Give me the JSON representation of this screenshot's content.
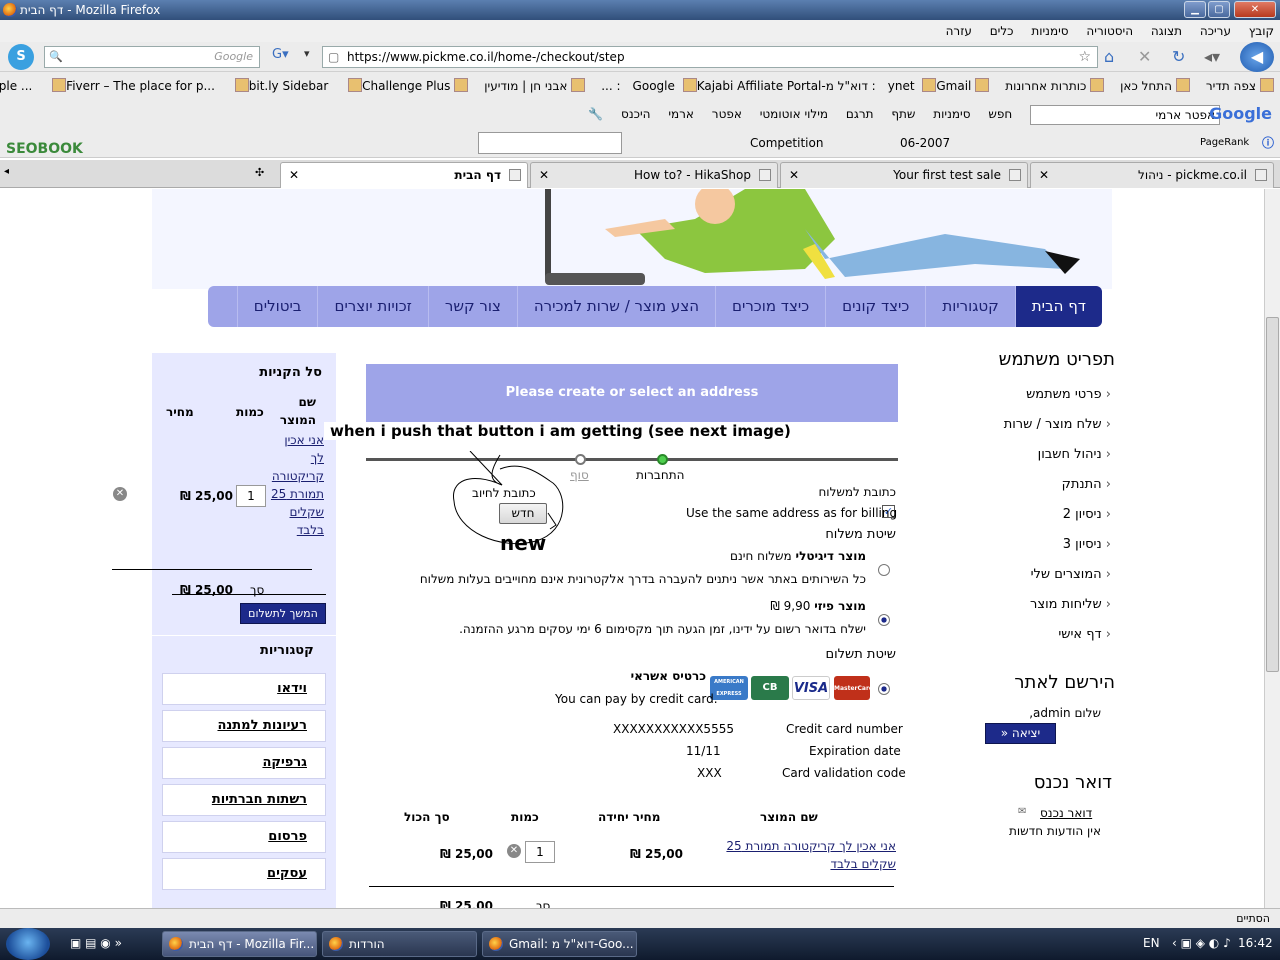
{
  "window": {
    "title": "דף הבית - Mozilla Firefox"
  },
  "menu": [
    "קובץ",
    "עריכה",
    "תצוגה",
    "היסטוריה",
    "סימניות",
    "כלים",
    "עזרה"
  ],
  "nav": {
    "url": "https://www.pickme.co.il/home-/checkout/step",
    "search_placeholder": "Google"
  },
  "bookmarks": [
    "צפה תדיר",
    "התחל כאן",
    "כותרות אחרונות",
    "ynet",
    "Gmail: דוא\"ל מ-Google",
    "Kajabi Affiliate Portal: ...",
    "אבני חן | מודיעין",
    "bit.ly | Basic | a simple ...",
    "Fiverr – The place for p...",
    "bit.ly Sidebar",
    "Challenge Plus"
  ],
  "toolbar1": {
    "google_search_value": "אפטר ארמי",
    "items": [
      "חפש",
      "סימניות",
      "שתף",
      "תרגם",
      "מילוי אוטומטי",
      "אפטר",
      "ארמי",
      "היכנס"
    ]
  },
  "toolbar2": {
    "brand": "SEOBOOK",
    "competition": "Competition",
    "pagerank": "PageRank",
    "date": "06-2007"
  },
  "tabs": [
    {
      "label": "ניהול - pickme.co.il"
    },
    {
      "label": "Your first test sale"
    },
    {
      "label": "How to? - HikaShop"
    },
    {
      "label": "דף הבית"
    }
  ],
  "mainnav": [
    "דף הבית",
    "קטגוריות",
    "כיצד קונים",
    "כיצד מוכרים",
    "הצע מוצר / שרות למכירה",
    "צור קשר",
    "זכויות יוצרים",
    "ביטולים"
  ],
  "cart": {
    "title": "סל הקניות",
    "col_name": "שם המוצר",
    "col_qty": "כמות",
    "col_price": "מחיר",
    "item_name": "אני אכין לך קריקטורה תמורת 25 שקלים בלבד",
    "item_qty": "1",
    "item_price": "25,00 ₪",
    "total_label": "סך",
    "total_value": "25,00 ₪",
    "continue_button": "המשך לתשלום"
  },
  "categories": {
    "title": "קטגוריות",
    "items": [
      "וידאו",
      "רעיונות למתנה",
      "גרפיקה",
      "רשתות חברתיות",
      "פרסום",
      "עסקים"
    ]
  },
  "checkout": {
    "address_banner": "Please create or select an address",
    "annotation": "when i push that button i am getting (see next image)",
    "annotation_new": "new",
    "steps": [
      "התחברות",
      "סוף"
    ],
    "billing_address_label": "כתובת לחיוב",
    "new_button": "חדש",
    "shipping_address_label": "כתובת למשלוח",
    "same_address_label": "Use the same address as for billing",
    "shipping_method_title": "שיטת משלוח",
    "ship1_name": "מוצר דיגיטלי",
    "ship1_price": "משלוח חינם",
    "ship1_desc": "כל השירותים באתר אשר ניתנים להעברה בדרך אלקטרונית אינם מחוייבים בעלות משלוח",
    "ship2_name": "מוצר פיזי",
    "ship2_price": "9,90 ₪",
    "ship2_desc": "ישלח בדואר רשום על ידינו, זמן הגעה תוך מקסימום 6 ימי עסקים מרגע ההזמנה.",
    "payment_method_title": "שיטת תשלום",
    "pay_name": "כרטיס אשראי",
    "pay_desc": "You can pay by credit card.",
    "cards": [
      "MasterCard",
      "VISA",
      "CB",
      "AMERICAN EXPRESS"
    ],
    "cc_number_label": "Credit card number",
    "cc_number_value": "XXXXXXXXXXX5555",
    "exp_label": "Expiration date",
    "exp_value": "11/11",
    "cvv_label": "Card validation code",
    "cvv_value": "XXX",
    "summary_cols": [
      "שם המוצר",
      "מחיר יחידה",
      "כמות",
      "סך הכול"
    ],
    "summary_item": "אני אכין לך קריקטורה תמורת 25 שקלים בלבד",
    "summary_unit_price": "25,00 ₪",
    "summary_qty": "1",
    "summary_total": "25,00 ₪",
    "summary_footer_label": "סך",
    "summary_footer_value": "25,00 ₪"
  },
  "usermenu": {
    "title": "תפריט משתמש",
    "items": [
      "פרטי משתמש",
      "שלח מוצר / שרות",
      "ניהול חשבון",
      "התנתק",
      "ניסיון 2",
      "ניסיון 3",
      "המוצרים שלי",
      "שליחות מוצר",
      "דף אישי"
    ]
  },
  "register": {
    "title": "הירשם לאתר",
    "greeting": "שלום admin,",
    "logout_button": "יציאה"
  },
  "mail": {
    "title": "דואר נכנס",
    "link": "דואר נכנס",
    "note": "אין הודעות חדשות"
  },
  "status": {
    "text": "הסתיים"
  },
  "taskbar": {
    "tasks": [
      "דף הבית - Mozilla Fir...",
      "הורדות",
      "Gmail: דוא\"ל מ-Goo..."
    ],
    "lang": "EN",
    "clock": "16:42"
  }
}
